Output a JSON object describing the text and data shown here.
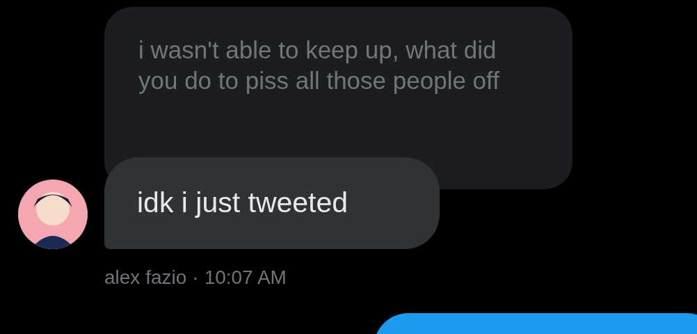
{
  "replied_message": {
    "text": "i wasn't able to keep up, what did you do to piss all those people off"
  },
  "message": {
    "text": "idk i just tweeted",
    "author": "alex fazio",
    "separator": "·",
    "time": "10:07 AM"
  }
}
